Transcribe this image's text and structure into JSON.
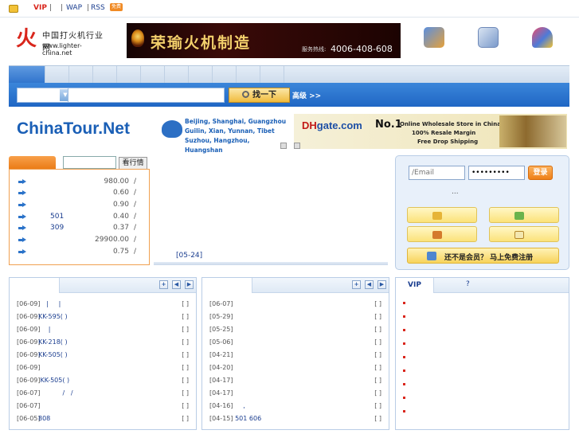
{
  "topbar": {
    "vip": "VIP",
    "sep1": "|",
    "sep2": "|",
    "wap": "WAP",
    "sep3": "|",
    "rss": "RSS",
    "rss_badge": "免费"
  },
  "logo": {
    "glyph": "火",
    "name": "中国打火机行业网",
    "url": "www.lighter-china.net"
  },
  "banner": {
    "title": "荣瑜火机制造",
    "hotline_label": "服务热线:",
    "phone": "4006-408-608"
  },
  "search": {
    "button": "找一下",
    "advanced": "高级 >>",
    "query": ""
  },
  "ads": {
    "tour": {
      "brand": "ChinaTour.Net",
      "cities": [
        "Beijing, Shanghai, Guangzhou",
        "Guilin, Xian, Yunnan, Tibet",
        "Suzhou, Hangzhou, Huangshan"
      ]
    },
    "dhgate": {
      "brand_a": "DH",
      "brand_b": "gate.com",
      "no1": "No.1",
      "line1": "Online Wholesale Store in China",
      "line2": "100% Resale Margin",
      "line3": "Free Drop Shipping"
    }
  },
  "price": {
    "view_button": "看行情",
    "input_value": "",
    "rows": [
      {
        "code": "",
        "value": "980.00",
        "sep": "/"
      },
      {
        "code": "",
        "value": "0.60",
        "sep": "/"
      },
      {
        "code": "",
        "value": "0.90",
        "sep": "/"
      },
      {
        "code": "501",
        "value": "0.40",
        "sep": "/"
      },
      {
        "code": "309",
        "value": "0.37",
        "sep": "/"
      },
      {
        "code": "",
        "value": "29900.00",
        "sep": "/"
      },
      {
        "code": "",
        "value": "0.75",
        "sep": "/"
      }
    ],
    "date": "[05-24]"
  },
  "login": {
    "email_placeholder": "/Email",
    "password_value": "•••••••••",
    "login_button": "登录",
    "dots": "...",
    "register_text": "还不是会员？ 马上免费注册"
  },
  "news_left": {
    "rows": [
      {
        "date": "[06-09]",
        "title": "    |     |",
        "bracket": "[ ]"
      },
      {
        "date": "[06-09]",
        "title": "KK-595( )",
        "bracket": "[ ]"
      },
      {
        "date": "[06-09]",
        "title": "     |",
        "bracket": "[ ]"
      },
      {
        "date": "[06-09]",
        "title": "KK-218( )",
        "bracket": "[ ]"
      },
      {
        "date": "[06-09]",
        "title": "KK-505( )",
        "bracket": "[ ]"
      },
      {
        "date": "[06-09]",
        "title": "",
        "bracket": "[ ]"
      },
      {
        "date": "[06-09]",
        "title": " KK-505( )",
        "bracket": "[ ]"
      },
      {
        "date": "[06-07]",
        "title": "            /   /",
        "bracket": "[ ]"
      },
      {
        "date": "[06-07]",
        "title": "",
        "bracket": "[ ]"
      },
      {
        "date": "[06-05]",
        "title": "808",
        "bracket": "[ ]"
      }
    ]
  },
  "news_mid": {
    "rows": [
      {
        "date": "[06-07]",
        "title": "",
        "bracket": "[ ]"
      },
      {
        "date": "[05-29]",
        "title": "",
        "bracket": "[ ]"
      },
      {
        "date": "[05-25]",
        "title": "",
        "bracket": "[ ]"
      },
      {
        "date": "[05-06]",
        "title": "",
        "bracket": "[ ]"
      },
      {
        "date": "[04-21]",
        "title": "",
        "bracket": "[ ]"
      },
      {
        "date": "[04-20]",
        "title": "",
        "bracket": "[ ]"
      },
      {
        "date": "[04-17]",
        "title": "",
        "bracket": "[ ]"
      },
      {
        "date": "[04-17]",
        "title": "",
        "bracket": "[ ]"
      },
      {
        "date": "[04-16]",
        "title": "      ,",
        "bracket": "[ ]"
      },
      {
        "date": "[04-15]",
        "title": "  501 606",
        "bracket": "[ ]"
      }
    ]
  },
  "vip_panel": {
    "tab1": "VIP",
    "tab2": "?"
  },
  "colors": {
    "nav_blue": "#2f73cc",
    "accent_orange": "#ee7f18",
    "link_blue": "#1a3d8f",
    "vip_red": "#d9261c"
  }
}
